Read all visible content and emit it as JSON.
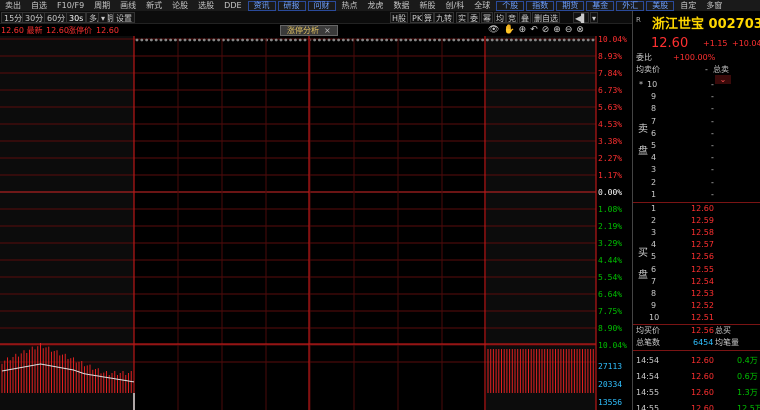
{
  "menu": [
    {
      "label": "卖出"
    },
    {
      "label": "自选"
    },
    {
      "label": "F10/F9"
    },
    {
      "label": "周期"
    },
    {
      "label": "画线"
    },
    {
      "label": "新式"
    },
    {
      "label": "论股"
    },
    {
      "label": "选股"
    },
    {
      "label": "DDE"
    },
    {
      "label": "资讯",
      "box": true
    },
    {
      "label": "研报",
      "box": true
    },
    {
      "label": "问财",
      "box": true
    },
    {
      "label": "热点"
    },
    {
      "label": "龙虎"
    },
    {
      "label": "数据"
    },
    {
      "label": "新股"
    },
    {
      "label": "创/科"
    },
    {
      "label": "全球"
    },
    {
      "label": "个股",
      "box": true
    },
    {
      "label": "指数",
      "box": true
    },
    {
      "label": "期货",
      "box": true
    },
    {
      "label": "基金",
      "box": true
    },
    {
      "label": "外汇",
      "box": true
    },
    {
      "label": "美股",
      "box": true
    },
    {
      "label": "自定"
    },
    {
      "label": "多窗"
    }
  ],
  "periods": [
    "15分",
    "30分",
    "60分",
    "30s",
    "多周期",
    "设置"
  ],
  "tools": [
    "H股",
    "PK",
    "算",
    "九转",
    "实",
    "委",
    "幂",
    "均",
    "竞",
    "叠",
    "删自选"
  ],
  "info": {
    "price_label": "12.60 最新",
    "price_val": "12.60",
    "limit_label": "涨停价",
    "limit_val": "12.60"
  },
  "tab": {
    "label": "涨停分析",
    "close": "×"
  },
  "chart_icons": [
    "👁",
    "✋",
    "⊕",
    "↶",
    "⊘",
    "⊕",
    "⊖",
    "⊗"
  ],
  "y_axis": {
    "up": [
      "10.04%",
      "8.93%",
      "7.84%",
      "6.73%",
      "5.63%",
      "4.53%",
      "3.38%",
      "2.27%",
      "1.17%"
    ],
    "zero": "0.00%",
    "down": [
      "1.08%",
      "2.19%",
      "3.29%",
      "4.44%",
      "5.54%",
      "6.64%",
      "7.75%",
      "8.90%",
      "10.04%"
    ],
    "vol": [
      "27113",
      "20334",
      "13556"
    ]
  },
  "colors": {
    "up": "#ff3030",
    "down": "#00c000",
    "grid": "#8a1010",
    "accent": "#ffd700",
    "cyan": "#30c0ff"
  },
  "stock": {
    "r": "R",
    "name": "浙江世宝 002703",
    "price": "12.60",
    "change": "+1.15",
    "change_pct": "+10.04",
    "wb_label": "委比",
    "wb_val": "+100.00%",
    "avg_sell_label": "均卖价",
    "total_sell_label": "总卖",
    "total_sell_val": "-"
  },
  "sell_side_label": [
    "卖",
    "盘"
  ],
  "buy_side_label": [
    "买",
    "盘"
  ],
  "asks": [
    {
      "n": "10",
      "p": "-"
    },
    {
      "n": "9",
      "p": "-"
    },
    {
      "n": "8",
      "p": "-"
    },
    {
      "n": "7",
      "p": "-"
    },
    {
      "n": "6",
      "p": "-"
    },
    {
      "n": "5",
      "p": "-"
    },
    {
      "n": "4",
      "p": "-"
    },
    {
      "n": "3",
      "p": "-"
    },
    {
      "n": "2",
      "p": "-"
    },
    {
      "n": "1",
      "p": "-"
    }
  ],
  "bids": [
    {
      "n": "1",
      "p": "12.60"
    },
    {
      "n": "2",
      "p": "12.59"
    },
    {
      "n": "3",
      "p": "12.58"
    },
    {
      "n": "4",
      "p": "12.57"
    },
    {
      "n": "5",
      "p": "12.56"
    },
    {
      "n": "6",
      "p": "12.55"
    },
    {
      "n": "7",
      "p": "12.54"
    },
    {
      "n": "8",
      "p": "12.53"
    },
    {
      "n": "9",
      "p": "12.52"
    },
    {
      "n": "10",
      "p": "12.51"
    }
  ],
  "summary": {
    "avg_buy_label": "均买价",
    "avg_buy_val": "12.56",
    "total_buy_label": "总买",
    "total_trades_label": "总笔数",
    "total_trades_val": "6454",
    "avg_trade_label": "均笔量"
  },
  "ticks": [
    {
      "t": "14:54",
      "p": "12.60",
      "v": "0.4万"
    },
    {
      "t": "14:54",
      "p": "12.60",
      "v": "0.6万"
    },
    {
      "t": "14:55",
      "p": "12.60",
      "v": "1.3万"
    },
    {
      "t": "14:55",
      "p": "12.60",
      "v": "12.5万"
    }
  ]
}
